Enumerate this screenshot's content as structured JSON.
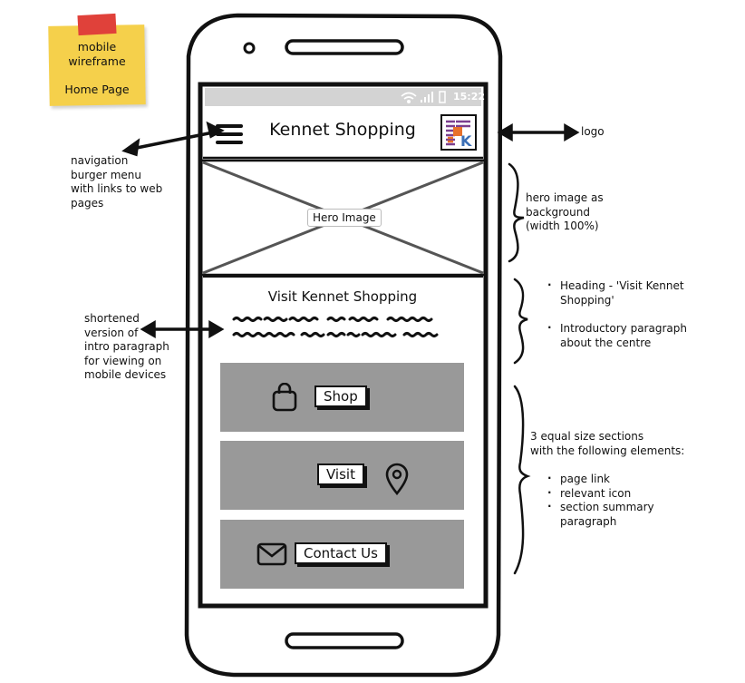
{
  "sticky_note": {
    "line1": "mobile",
    "line2": "wireframe",
    "line3": "Home Page"
  },
  "phone": {
    "status_time": "15:22",
    "header": {
      "title": "Kennet Shopping",
      "logo_letter": "K"
    },
    "hero": {
      "label": "Hero Image"
    },
    "intro": {
      "heading": "Visit Kennet Shopping"
    },
    "sections": [
      {
        "label": "Shop",
        "icon": "shopping-bag-icon"
      },
      {
        "label": "Visit",
        "icon": "map-pin-icon"
      },
      {
        "label": "Contact Us",
        "icon": "envelope-icon"
      }
    ]
  },
  "annotations": {
    "nav": [
      "navigation",
      "burger menu",
      "with links to web",
      "pages"
    ],
    "logo": "logo",
    "hero": [
      "hero image as",
      "background",
      "(width 100%)"
    ],
    "intro_short": [
      "shortened",
      "version of",
      "intro paragraph",
      "for viewing on",
      "mobile devices"
    ],
    "heading_bullets": [
      "Heading - 'Visit Kennet Shopping'",
      "Introductory paragraph about the centre"
    ],
    "sections_title": [
      "3 equal size sections",
      "with the following elements:"
    ],
    "sections_bullets": [
      "page link",
      "relevant icon",
      "section summary paragraph"
    ]
  },
  "colors": {
    "sticky": "#f5d04b",
    "tape": "#e0413a",
    "section_fill": "#999999",
    "statusbar": "#d3d3d3",
    "logo_purple": "#7b3f8f",
    "logo_orange": "#e8712b",
    "logo_blue": "#3b6fb6"
  }
}
